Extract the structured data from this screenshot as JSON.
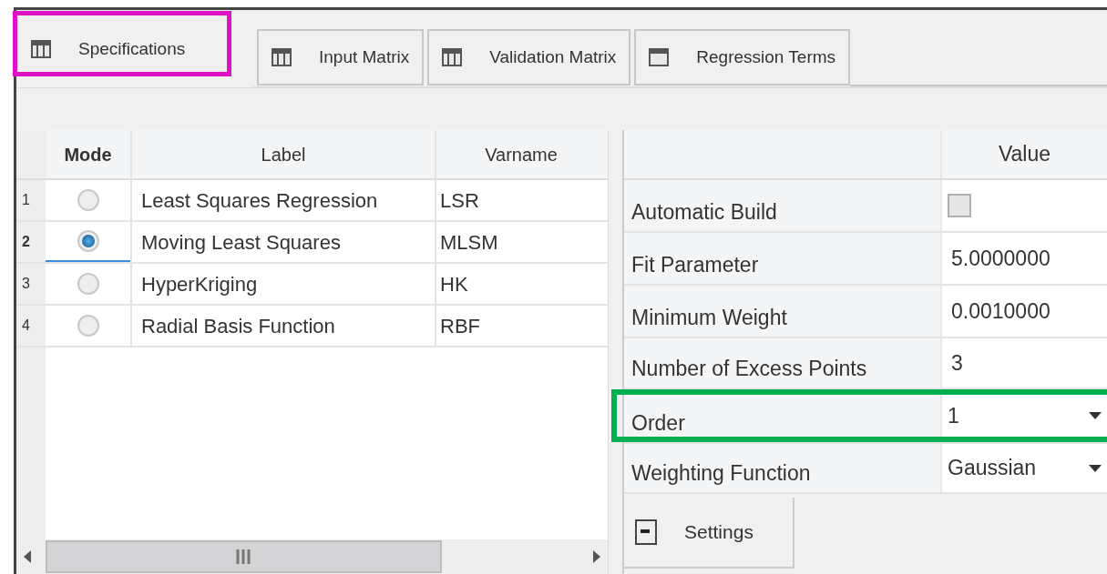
{
  "tabs": [
    {
      "label": "Specifications",
      "selected": true,
      "highlighted": true
    },
    {
      "label": "Input Matrix",
      "selected": false,
      "highlighted": false
    },
    {
      "label": "Validation Matrix",
      "selected": false,
      "highlighted": false
    },
    {
      "label": "Regression Terms",
      "selected": false,
      "highlighted": false
    }
  ],
  "modes_table": {
    "columns": [
      "Mode",
      "Label",
      "Varname"
    ],
    "rows": [
      {
        "number": "1",
        "selected": false,
        "label": "Least Squares Regression",
        "varname": "LSR"
      },
      {
        "number": "2",
        "selected": true,
        "label": "Moving Least Squares",
        "varname": "MLSM"
      },
      {
        "number": "3",
        "selected": false,
        "label": "HyperKriging",
        "varname": "HK"
      },
      {
        "number": "4",
        "selected": false,
        "label": "Radial Basis Function",
        "varname": "RBF"
      }
    ]
  },
  "properties": {
    "value_column": "Value",
    "rows": [
      {
        "label": "Automatic Build",
        "kind": "checkbox",
        "checked": false,
        "highlighted": false
      },
      {
        "label": "Fit Parameter",
        "kind": "text",
        "value": "5.0000000",
        "highlighted": false
      },
      {
        "label": "Minimum Weight",
        "kind": "text",
        "value": "0.0010000",
        "highlighted": false
      },
      {
        "label": "Number of Excess Points",
        "kind": "text",
        "value": "3",
        "highlighted": false
      },
      {
        "label": "Order",
        "kind": "dropdown",
        "value": "1",
        "highlighted": true
      },
      {
        "label": "Weighting Function",
        "kind": "dropdown",
        "value": "Gaussian",
        "highlighted": false
      }
    ]
  },
  "bottom_tab": {
    "label": "Settings"
  }
}
